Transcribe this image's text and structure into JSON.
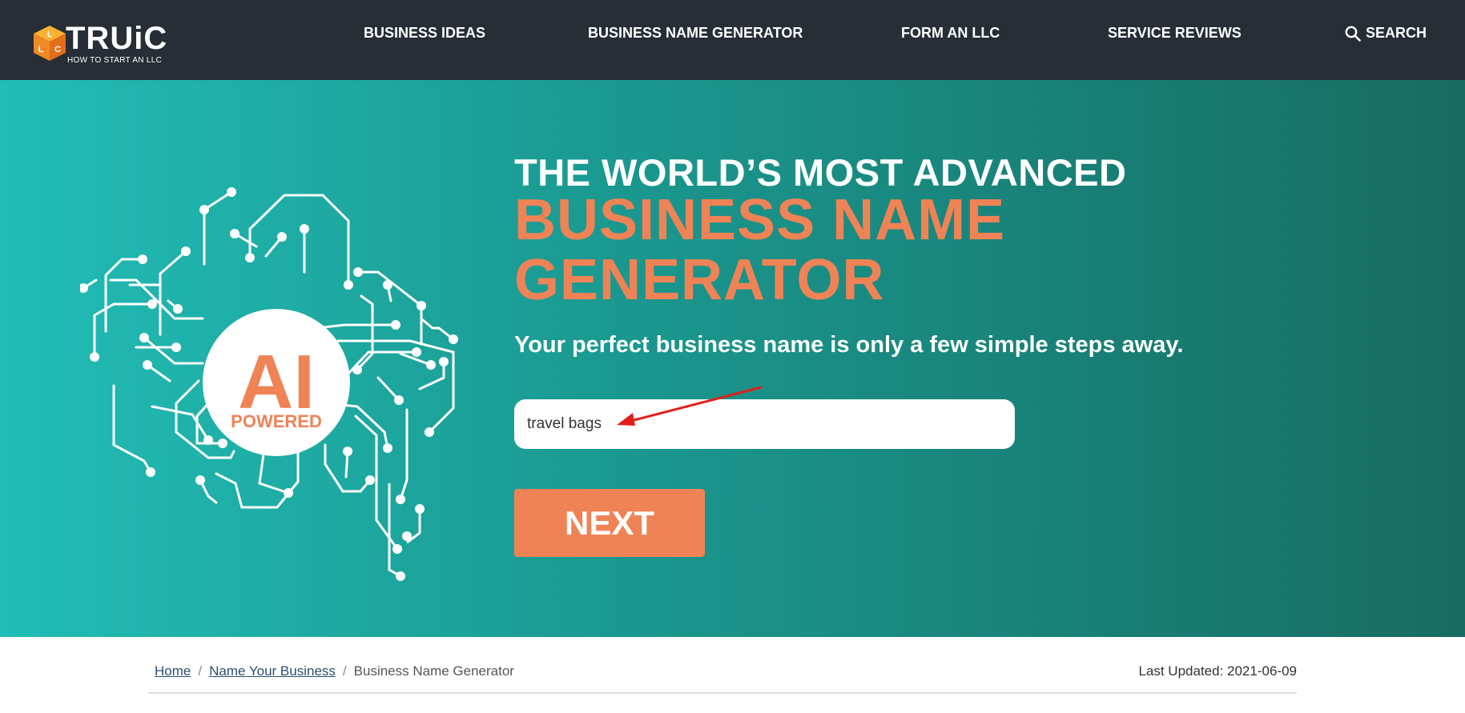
{
  "logo": {
    "brand": "TRUiC",
    "tagline": "HOW TO START AN LLC",
    "cube_letters": [
      "L",
      "L",
      "C"
    ]
  },
  "nav": {
    "items": [
      {
        "label": "BUSINESS IDEAS"
      },
      {
        "label": "BUSINESS NAME GENERATOR"
      },
      {
        "label": "FORM AN LLC"
      },
      {
        "label": "SERVICE REVIEWS"
      }
    ],
    "search_label": "SEARCH",
    "search_icon": "magnifier-icon"
  },
  "hero": {
    "badge_big": "AI",
    "badge_small": "POWERED",
    "headline_top": "THE WORLD’S MOST ADVANCED",
    "headline_line1": "BUSINESS NAME",
    "headline_line2": "GENERATOR",
    "subhead": "Your perfect business name is only a few simple steps away.",
    "input_value": "travel bags",
    "next_label": "NEXT"
  },
  "breadcrumb": {
    "items": [
      {
        "label": "Home"
      },
      {
        "label": "Name Your Business"
      },
      {
        "label": "Business Name Generator"
      }
    ],
    "separator": "/"
  },
  "last_updated": "Last Updated: 2021-06-09",
  "colors": {
    "nav_bg": "#272e35",
    "hero_start": "#21bdb6",
    "hero_end": "#176c62",
    "accent_orange": "#ef8356",
    "annotation_arrow": "#e0201b"
  }
}
